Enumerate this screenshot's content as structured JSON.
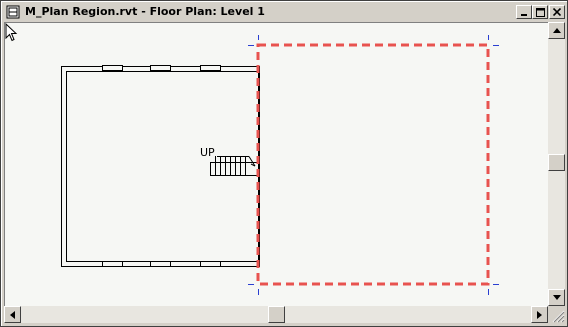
{
  "window": {
    "title": "M_Plan Region.rvt - Floor Plan: Level 1",
    "controls": [
      "minimize",
      "maximize",
      "close"
    ]
  },
  "view": {
    "stair_label": "UP",
    "plan_region_color": "#e8534f",
    "wall_color": "#000000",
    "canvas_background": "#f6f7f4"
  },
  "icons": {
    "app": "revit-document-icon",
    "cursor": "mouse-pointer-icon",
    "scroll_up": "arrow-up-icon",
    "scroll_down": "arrow-down-icon",
    "scroll_left": "arrow-left-icon",
    "scroll_right": "arrow-right-icon"
  }
}
